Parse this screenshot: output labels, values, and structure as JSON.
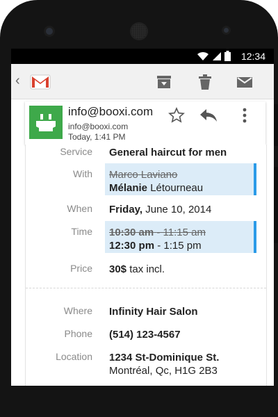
{
  "status_bar": {
    "time": "12:34"
  },
  "sender": {
    "email": "info@booxi.com",
    "sub_email": "info@booxi.com",
    "date": "Today, 1:41 PM"
  },
  "details": {
    "service": {
      "label": "Service",
      "value": "General haircut for men"
    },
    "with": {
      "label": "With",
      "old_first": "Marco",
      "old_last": "Laviano",
      "new_first": "Mélanie",
      "new_last": "Létourneau"
    },
    "when": {
      "label": "When",
      "day": "Friday,",
      "date": "June 10, 2014"
    },
    "time": {
      "label": "Time",
      "old_start": "10:30 am",
      "old_end": "- 11:15 am",
      "new_start": "12:30 pm",
      "new_end": "- 1:15 pm"
    },
    "price": {
      "label": "Price",
      "amount": "30$",
      "suffix": "tax incl."
    },
    "where": {
      "label": "Where",
      "value": "Infinity Hair Salon"
    },
    "phone": {
      "label": "Phone",
      "value": "(514) 123-4567"
    },
    "location": {
      "label": "Location",
      "line1": "1234 St-Dominique St.",
      "line2": "Montréal, Qc, H1G 2B3"
    }
  },
  "colors": {
    "accent_blue": "#2b9be8",
    "highlight": "#dcecf8",
    "avatar_green": "#3ea94a",
    "gmail_red": "#d9412f"
  },
  "icons": [
    "back-icon",
    "gmail-icon",
    "archive-icon",
    "trash-icon",
    "mail-icon",
    "star-icon",
    "reply-icon",
    "overflow-menu-icon",
    "wifi-icon",
    "signal-icon",
    "battery-icon"
  ]
}
